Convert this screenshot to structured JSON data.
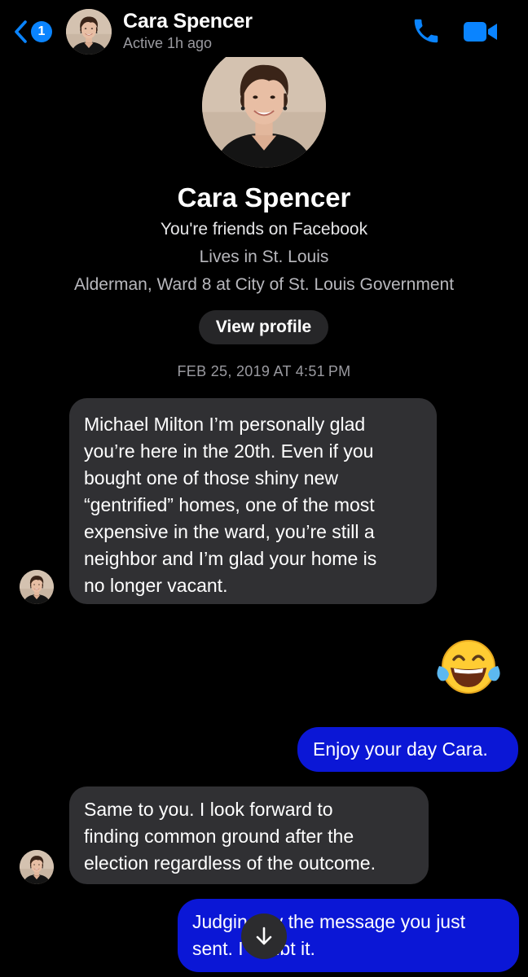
{
  "header": {
    "unread_count": "1",
    "name": "Cara Spencer",
    "status": "Active 1h ago"
  },
  "profile": {
    "name": "Cara Spencer",
    "friends_line": "You're friends on Facebook",
    "lives_line": "Lives in St. Louis",
    "work_line": "Alderman, Ward 8 at City of St. Louis Government",
    "view_profile_label": "View profile"
  },
  "timestamp": "FEB 25, 2019 AT 4:51 PM",
  "messages": [
    {
      "sender": "Cara Spencer",
      "lines": [
        "Michael Milton I’m personally glad",
        "you’re here in the 20th. Even if you",
        "bought one of those shiny new",
        "“gentrified” homes, one of the most",
        "expensive in the ward, you’re still a",
        "neighbor and I’m glad your home is",
        "no longer vacant."
      ]
    },
    {
      "sender": "me",
      "emoji": "😂"
    },
    {
      "sender": "me",
      "lines": [
        "Enjoy your day Cara."
      ]
    },
    {
      "sender": "Cara Spencer",
      "lines": [
        "Same to you. I look forward to",
        "finding common ground after the",
        "election regardless of the outcome."
      ]
    },
    {
      "sender": "me",
      "lines": [
        "Judging by the message you just",
        "sent. I doubt it."
      ]
    }
  ],
  "colors": {
    "accent": "#0a84ff",
    "outgoing_bubble": "#0b17d6",
    "incoming_bubble": "#303033",
    "background": "#000000"
  },
  "icons": {
    "back": "chevron-left-icon",
    "call": "phone-icon",
    "video": "video-camera-icon",
    "scroll": "arrow-down-icon"
  }
}
